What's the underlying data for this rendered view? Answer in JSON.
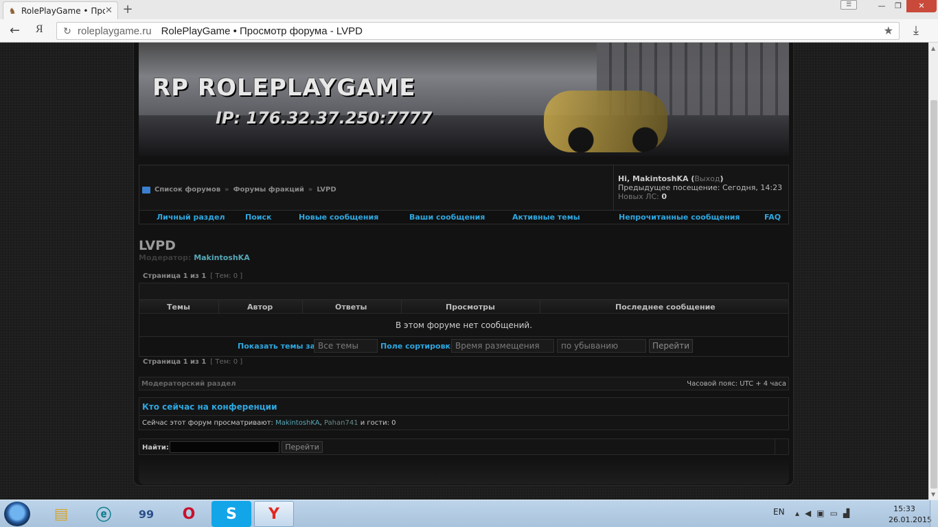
{
  "browser": {
    "tab_title": "RolePlayGame • Просм",
    "new_tab": "+",
    "domain": "roleplaygame.ru",
    "page_title": "RolePlayGame • Просмотр форума - LVPD",
    "ya_label": "Я"
  },
  "banner": {
    "logo_text": "RP  ROLEPLAYGAME",
    "ip_text": "IP: 176.32.37.250:7777"
  },
  "breadcrumbs": [
    "Список форумов",
    "Форумы фракций",
    "LVPD"
  ],
  "breadcrumb_sep": "»",
  "user": {
    "greeting": "Hi, MakintoshKA (",
    "logout": "Выход",
    "greeting_end": ")",
    "last_visit": "Предыдущее посещение: Сегодня, 14:23",
    "new_pm_label": "Новых ЛС: ",
    "new_pm_count": "0"
  },
  "menu": [
    "Личный раздел",
    "Поиск",
    "Новые сообщения",
    "Ваши сообщения",
    "Активные темы",
    "Непрочитанные сообщения",
    "FAQ"
  ],
  "forum": {
    "title": "LVPD",
    "moderator_label": "Модератор: ",
    "moderator": "MakintoshKA",
    "pager": "Страница 1 из 1",
    "topics_count": "[ Тем: 0 ]",
    "columns": [
      "Темы",
      "Автор",
      "Ответы",
      "Просмотры",
      "Последнее сообщение"
    ],
    "empty_message": "В этом форуме нет сообщений.",
    "show_topics_label": "Показать темы за:",
    "show_topics_value": "Все темы",
    "sort_label": "Поле сортировки",
    "sort_field_value": "Время размещения",
    "sort_dir_value": "по убыванию",
    "go_button": "Перейти"
  },
  "modbar": {
    "left": "Модераторский раздел",
    "right": "Часовой пояс: UTC + 4 часа"
  },
  "online": {
    "heading": "Кто сейчас на конференции",
    "prefix": "Сейчас этот форум просматривают: ",
    "user1": "MakintoshKA",
    "comma": ", ",
    "user2": "Pahan741",
    "suffix": " и гости: 0"
  },
  "search": {
    "label": "Найти:",
    "button": "Перейти"
  },
  "taskbar": {
    "lang": "EN",
    "time": "15:33",
    "date": "26.01.2015"
  },
  "colors": {
    "link_blue": "#2fa7e0",
    "user_teal": "#56a8b8",
    "page_bg": "#1b1b1b"
  }
}
